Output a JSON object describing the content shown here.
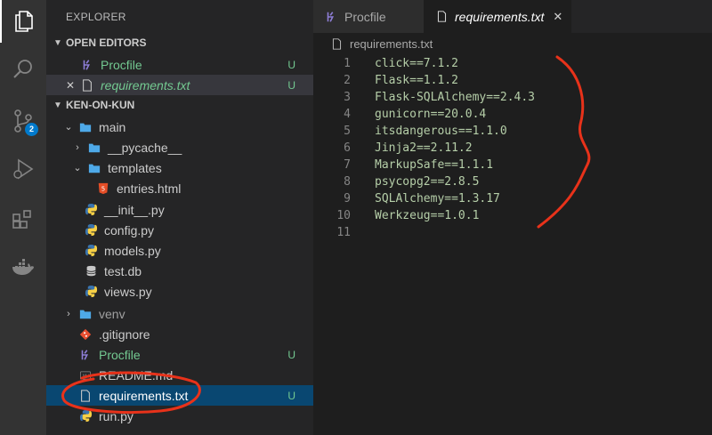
{
  "activity_bar": {
    "items": [
      {
        "icon": "files-icon"
      },
      {
        "icon": "search-icon"
      },
      {
        "icon": "source-control-icon",
        "badge": "2"
      },
      {
        "icon": "run-debug-icon"
      },
      {
        "icon": "extensions-icon"
      },
      {
        "icon": "docker-icon"
      }
    ]
  },
  "sidebar": {
    "title": "EXPLORER",
    "open_editors": {
      "header": "OPEN EDITORS",
      "items": [
        {
          "label": "Procfile",
          "status": "U"
        },
        {
          "label": "requirements.txt",
          "status": "U"
        }
      ]
    },
    "project": {
      "header": "KEN-ON-KUN",
      "tree": [
        {
          "label": "main"
        },
        {
          "label": "__pycache__"
        },
        {
          "label": "templates"
        },
        {
          "label": "entries.html"
        },
        {
          "label": "__init__.py"
        },
        {
          "label": "config.py"
        },
        {
          "label": "models.py"
        },
        {
          "label": "test.db"
        },
        {
          "label": "views.py"
        },
        {
          "label": "venv"
        },
        {
          "label": ".gitignore"
        },
        {
          "label": "Procfile",
          "status": "U"
        },
        {
          "label": "README.md"
        },
        {
          "label": "requirements.txt",
          "status": "U"
        },
        {
          "label": "run.py"
        }
      ]
    }
  },
  "tabs": [
    {
      "label": "Procfile"
    },
    {
      "label": "requirements.txt",
      "close": "✕"
    }
  ],
  "breadcrumb": "requirements.txt",
  "editor": {
    "lines": [
      {
        "num": "1",
        "text": "click==7.1.2"
      },
      {
        "num": "2",
        "text": "Flask==1.1.2"
      },
      {
        "num": "3",
        "text": "Flask-SQLAlchemy==2.4.3"
      },
      {
        "num": "4",
        "text": "gunicorn==20.0.4"
      },
      {
        "num": "5",
        "text": "itsdangerous==1.1.0"
      },
      {
        "num": "6",
        "text": "Jinja2==2.11.2"
      },
      {
        "num": "7",
        "text": "MarkupSafe==1.1.1"
      },
      {
        "num": "8",
        "text": "psycopg2==2.8.5"
      },
      {
        "num": "9",
        "text": "SQLAlchemy==1.3.17"
      },
      {
        "num": "10",
        "text": "Werkzeug==1.0.1"
      },
      {
        "num": "11",
        "text": ""
      }
    ]
  },
  "colors": {
    "accent": "#007acc",
    "selection": "#094771",
    "untracked": "#73c991",
    "annotation": "#e8321a"
  }
}
